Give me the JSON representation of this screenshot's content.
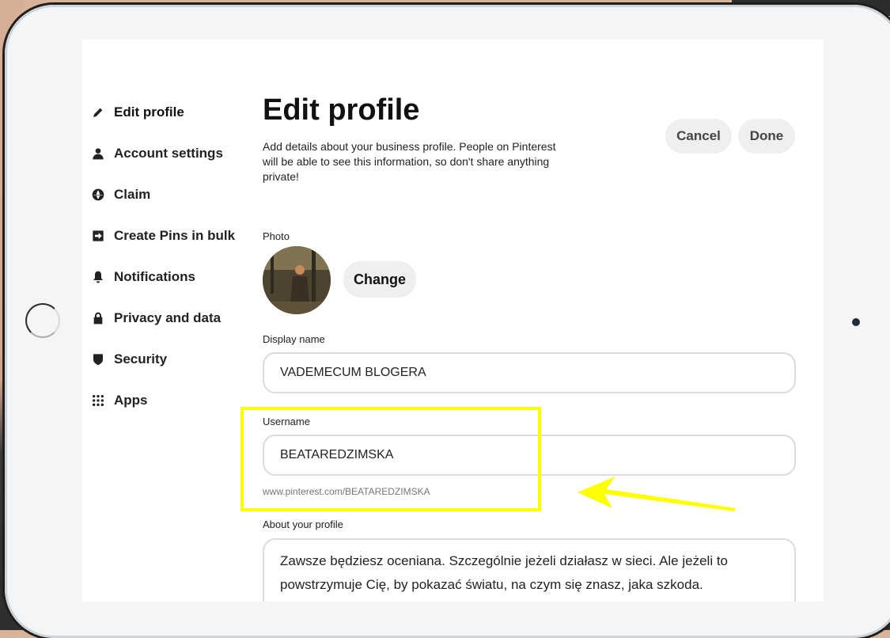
{
  "sidebar": {
    "items": [
      {
        "label": "Edit profile",
        "icon": "pencil-icon"
      },
      {
        "label": "Account settings",
        "icon": "person-icon"
      },
      {
        "label": "Claim",
        "icon": "globe-icon"
      },
      {
        "label": "Create Pins in bulk",
        "icon": "import-icon"
      },
      {
        "label": "Notifications",
        "icon": "bell-icon"
      },
      {
        "label": "Privacy and data",
        "icon": "lock-icon"
      },
      {
        "label": "Security",
        "icon": "shield-icon"
      },
      {
        "label": "Apps",
        "icon": "apps-grid-icon"
      }
    ]
  },
  "main": {
    "title": "Edit profile",
    "subtitle": "Add details about your business profile. People on Pinterest will be able to see this information, so don't share anything private!",
    "cancel_label": "Cancel",
    "done_label": "Done",
    "photo_label": "Photo",
    "change_label": "Change",
    "display_name_label": "Display name",
    "display_name_value": "VADEMECUM BLOGERA",
    "username_label": "Username",
    "username_value": "BEATAREDZIMSKA",
    "profile_url": "www.pinterest.com/BEATAREDZIMSKA",
    "about_label": "About your profile",
    "about_value": "Zawsze będziesz oceniana. Szczególnie jeżeli działasz w sieci. Ale jeżeli to powstrzymuje Cię, by pokazać światu, na czym się znasz, jaka szkoda."
  },
  "colors": {
    "highlight": "#ffff00",
    "button_bg": "#efefef",
    "text": "#222222"
  }
}
